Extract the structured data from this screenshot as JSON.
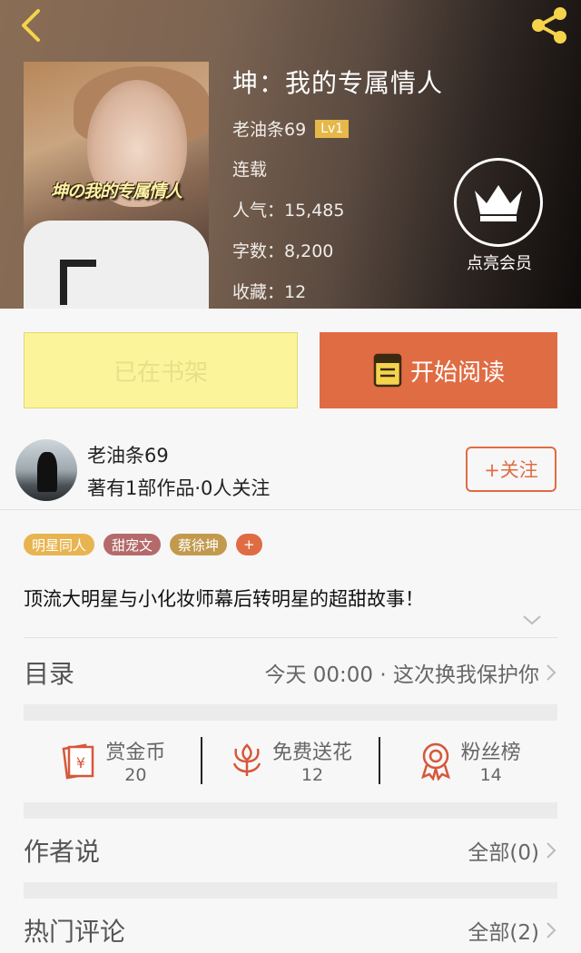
{
  "book": {
    "title": "坤：我的专属情人",
    "cover_title": "坤の我的专属情人",
    "author": "老油条69",
    "level": "Lv1",
    "status": "连载",
    "popularity": "人气：15,485",
    "word_count": "字数：8,200",
    "favorites": "收藏：12"
  },
  "vip": {
    "label": "点亮会员"
  },
  "actions": {
    "shelf_label": "已在书架",
    "read_label": "开始阅读"
  },
  "author": {
    "name": "老油条69",
    "stats": "著有1部作品·0人关注",
    "follow_label": "+关注"
  },
  "tags": [
    {
      "label": "明星同人",
      "color": "#e8b450"
    },
    {
      "label": "甜宠文",
      "color": "#b46a6a"
    },
    {
      "label": "蔡徐坤",
      "color": "#c29a4e"
    },
    {
      "label": "+",
      "color": "#e06c43"
    }
  ],
  "description": "顶流大明星与小化妆师幕后转明星的超甜故事！",
  "toc": {
    "label": "目录",
    "latest": "今天 00:00 · 这次换我保护你"
  },
  "stats": [
    {
      "label": "赏金币",
      "value": "20",
      "icon": "coin-envelope-icon"
    },
    {
      "label": "免费送花",
      "value": "12",
      "icon": "flower-icon"
    },
    {
      "label": "粉丝榜",
      "value": "14",
      "icon": "medal-icon"
    }
  ],
  "author_says": {
    "label": "作者说",
    "right": "全部(0)"
  },
  "hot_comments": {
    "label": "热门评论",
    "right": "全部(2)"
  },
  "colors": {
    "accent": "#e06c43",
    "shelf_bg": "#fcf49a",
    "level_badge": "#e6b84a"
  }
}
